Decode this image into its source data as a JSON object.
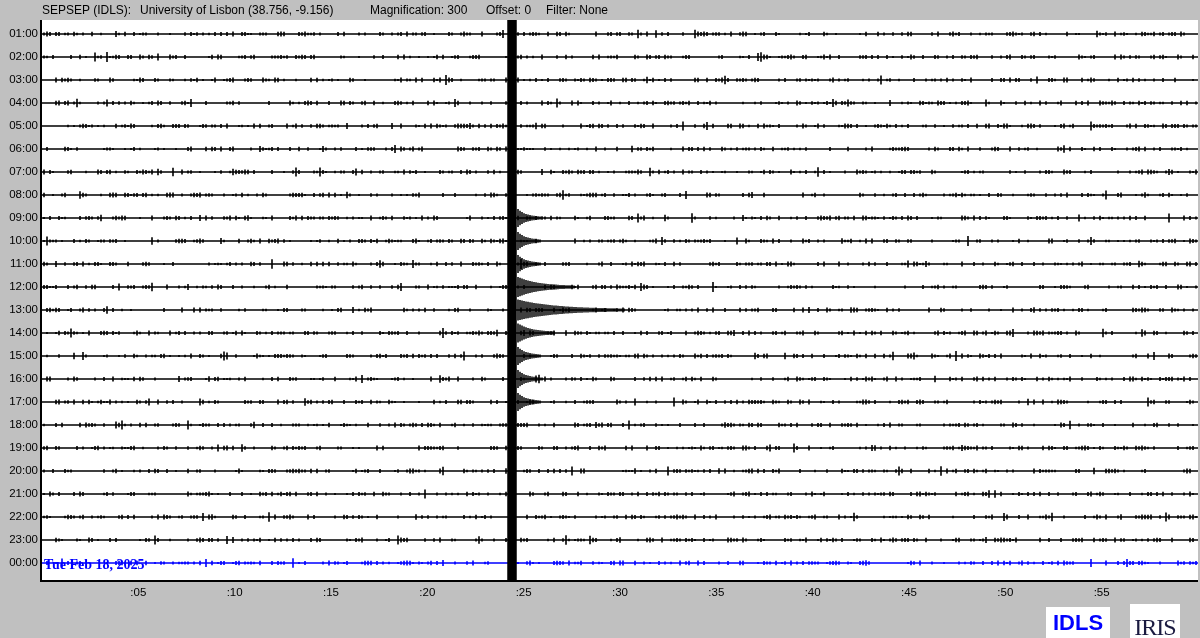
{
  "header": {
    "station": "SEPSEP (IDLS):",
    "location": "University of Lisbon (38.756, -9.156)",
    "magnification": "Magnification: 300",
    "offset": "Offset: 0",
    "filter": "Filter: None"
  },
  "rows": [
    {
      "label": "01:00",
      "color": "#000000"
    },
    {
      "label": "02:00",
      "color": "#000000"
    },
    {
      "label": "03:00",
      "color": "#000000"
    },
    {
      "label": "04:00",
      "color": "#000000"
    },
    {
      "label": "05:00",
      "color": "#000000"
    },
    {
      "label": "06:00",
      "color": "#000000"
    },
    {
      "label": "07:00",
      "color": "#000000"
    },
    {
      "label": "08:00",
      "color": "#000000"
    },
    {
      "label": "09:00",
      "color": "#000000"
    },
    {
      "label": "10:00",
      "color": "#000000"
    },
    {
      "label": "11:00",
      "color": "#000000"
    },
    {
      "label": "12:00",
      "color": "#000000"
    },
    {
      "label": "13:00",
      "color": "#000000"
    },
    {
      "label": "14:00",
      "color": "#000000"
    },
    {
      "label": "15:00",
      "color": "#000000"
    },
    {
      "label": "16:00",
      "color": "#000000"
    },
    {
      "label": "17:00",
      "color": "#000000"
    },
    {
      "label": "18:00",
      "color": "#000000"
    },
    {
      "label": "19:00",
      "color": "#000000"
    },
    {
      "label": "20:00",
      "color": "#000000"
    },
    {
      "label": "21:00",
      "color": "#000000"
    },
    {
      "label": "22:00",
      "color": "#000000"
    },
    {
      "label": "23:00",
      "color": "#000000"
    },
    {
      "label": "00:00",
      "color": "#0000ff"
    }
  ],
  "date": "Tue Feb 18, 2025",
  "time_ticks": [
    ":05",
    ":10",
    ":15",
    ":20",
    ":25",
    ":30",
    ":35",
    ":40",
    ":45",
    ":50",
    ":55"
  ],
  "logos": {
    "network": "IDLS",
    "iris": "IRIS"
  }
}
